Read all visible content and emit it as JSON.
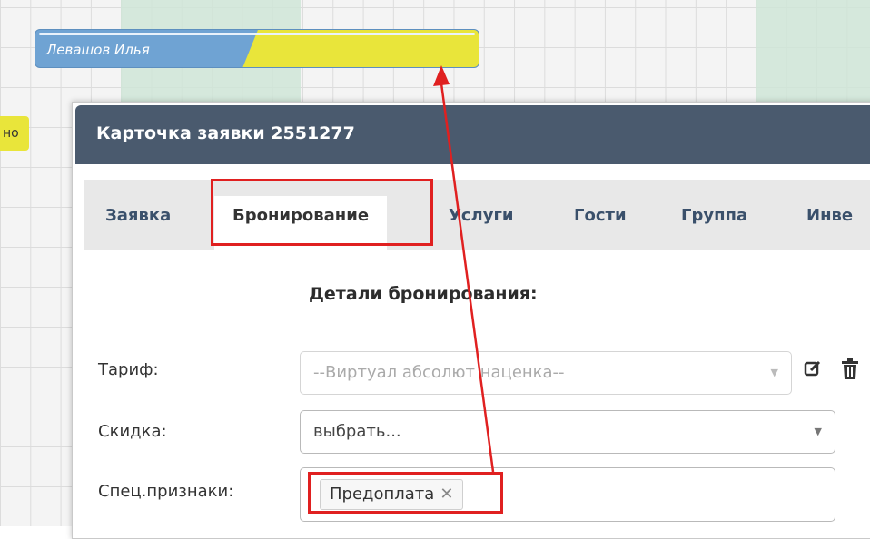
{
  "calendar": {
    "booking_label": "Левашов Илья",
    "side_chip_label": "но"
  },
  "dialog": {
    "title": "Карточка заявки 2551277",
    "tabs": [
      {
        "label": "Заявка"
      },
      {
        "label": "Бронирование"
      },
      {
        "label": "Услуги"
      },
      {
        "label": "Гости"
      },
      {
        "label": "Группа"
      },
      {
        "label": "Инве"
      }
    ],
    "active_tab": "Бронирование",
    "section_title": "Детали бронирования:",
    "form": {
      "tariff_label": "Тариф:",
      "tariff_value": "--Виртуал абсолют наценка--",
      "discount_label": "Скидка:",
      "discount_value": "выбрать...",
      "special_label": "Спец.признаки:",
      "special_tags": [
        {
          "label": "Предоплата",
          "remove": "✕"
        }
      ]
    },
    "icons": {
      "edit": "edit-icon",
      "delete": "trash-icon"
    }
  },
  "colors": {
    "header_bg": "#4a5a6e",
    "booking_blue": "#6fa3d3",
    "booking_yellow": "#e9e53a",
    "highlight_red": "#e02020"
  }
}
